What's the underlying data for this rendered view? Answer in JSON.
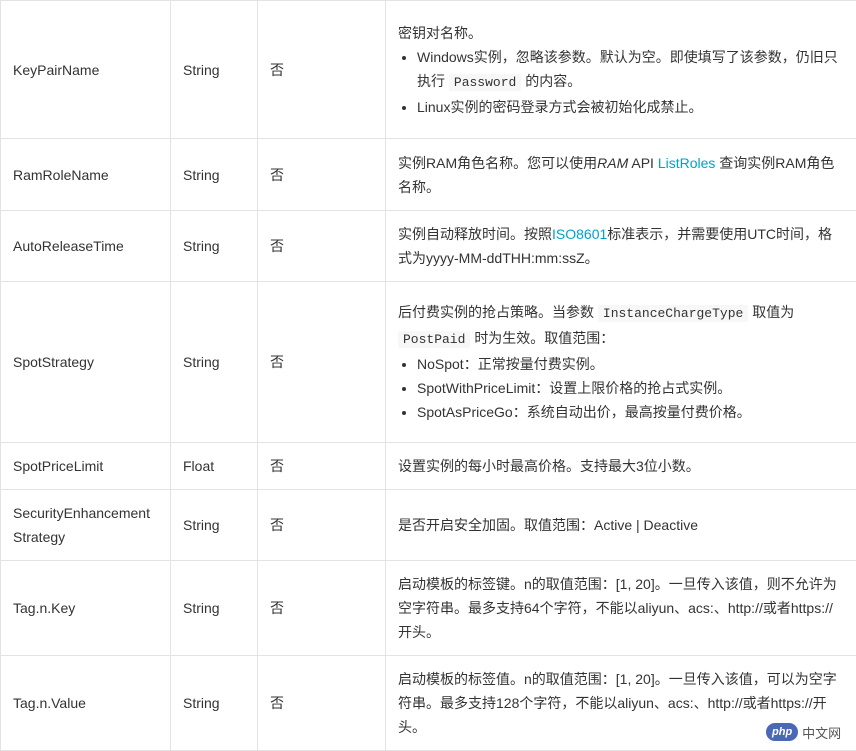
{
  "rows": [
    {
      "name": "KeyPairName",
      "type": "String",
      "required": "否",
      "desc_line": "密钥对名称。",
      "bullets": {
        "b1_pre": "Windows实例，忽略该参数。默认为空。即使填写了该参数，仍旧只执行",
        "b1_code": "Password",
        "b1_post": "的内容。",
        "b2": "Linux实例的密码登录方式会被初始化成禁止。"
      }
    },
    {
      "name": "RamRoleName",
      "type": "String",
      "required": "否",
      "desc_pre": "实例RAM角色名称。您可以使用",
      "desc_em": "RAM",
      "desc_mid": " API ",
      "desc_link": "ListRoles",
      "desc_post": " 查询实例RAM角色名称。"
    },
    {
      "name": "AutoReleaseTime",
      "type": "String",
      "required": "否",
      "desc_pre": "实例自动释放时间。按照",
      "desc_link": "ISO8601",
      "desc_post": "标准表示，并需要使用UTC时间，格式为yyyy-MM-ddTHH:mm:ssZ。"
    },
    {
      "name": "SpotStrategy",
      "type": "String",
      "required": "否",
      "desc_pre": "后付费实例的抢占策略。当参数",
      "code1": "InstanceChargeType",
      "desc_mid": "取值为",
      "code2": "PostPaid",
      "desc_post": "时为生效。取值范围：",
      "bullets": [
        "NoSpot：正常按量付费实例。",
        "SpotWithPriceLimit：设置上限价格的抢占式实例。",
        "SpotAsPriceGo：系统自动出价，最高按量付费价格。"
      ]
    },
    {
      "name": "SpotPriceLimit",
      "type": "Float",
      "required": "否",
      "desc": "设置实例的每小时最高价格。支持最大3位小数。"
    },
    {
      "name": "SecurityEnhancementStrategy",
      "type": "String",
      "required": "否",
      "desc": "是否开启安全加固。取值范围：Active | Deactive"
    },
    {
      "name": "Tag.n.Key",
      "type": "String",
      "required": "否",
      "desc": "启动模板的标签键。n的取值范围：[1, 20]。一旦传入该值，则不允许为空字符串。最多支持64个字符，不能以aliyun、acs:、http://或者https://开头。"
    },
    {
      "name": "Tag.n.Value",
      "type": "String",
      "required": "否",
      "desc": "启动模板的标签值。n的取值范围：[1, 20]。一旦传入该值，可以为空字符串。最多支持128个字符，不能以aliyun、acs:、http://或者https://开头。"
    }
  ],
  "watermark": {
    "logo": "php",
    "text": "中文网"
  },
  "colors": {
    "link": "#00a2ca",
    "border": "#e3e3e3",
    "text": "#333333"
  }
}
